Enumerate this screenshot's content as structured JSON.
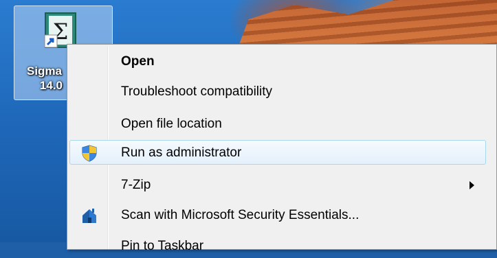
{
  "desktop": {
    "icon": {
      "label_line1": "Sigma",
      "label_line2": "14.0",
      "icon_name": "sigma-shortcut-icon"
    }
  },
  "context_menu": {
    "items": [
      {
        "label": "Open",
        "bold": true
      },
      {
        "label": "Troubleshoot compatibility"
      },
      {
        "label": "Open file location"
      },
      {
        "label": "Run as administrator",
        "icon": "uac-shield-icon",
        "highlighted": true
      },
      {
        "label": "7-Zip",
        "submenu": true
      },
      {
        "label": "Scan with Microsoft Security Essentials...",
        "icon": "mse-house-icon"
      },
      {
        "label": "Pin to Taskbar"
      }
    ]
  },
  "colors": {
    "menu_background": "#f0f0f0",
    "highlight_border": "#a8d8eb",
    "icon_selection": "#bed7f5"
  }
}
